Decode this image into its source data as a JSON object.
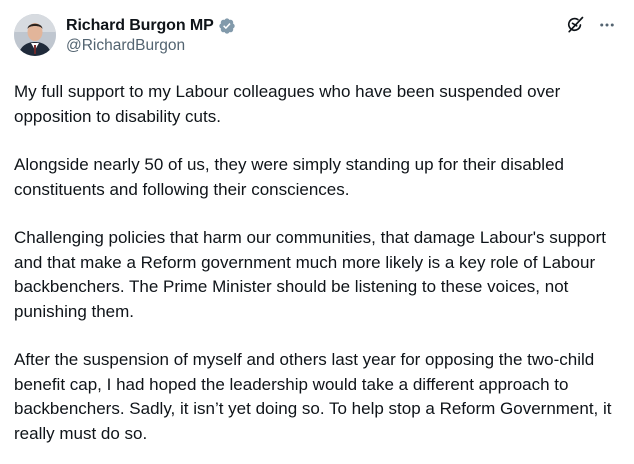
{
  "author": {
    "display_name": "Richard Burgon MP",
    "handle": "@RichardBurgon",
    "verified": true,
    "verified_color": "#829aab"
  },
  "icons": {
    "avatar": "avatar-photo",
    "verified": "verified-badge-icon",
    "grok": "grok-icon",
    "more": "more-options-icon"
  },
  "tweet": {
    "paragraphs": [
      "My full support to my Labour colleagues who have been suspended over opposition to disability cuts.",
      "Alongside nearly 50 of us, they were simply standing up for their disabled constituents and following their consciences.",
      "Challenging policies that harm our communities, that damage Labour's support and that make a Reform government much more likely is a key role of Labour backbenchers. The Prime Minister should be listening to these voices, not punishing them.",
      "After the suspension of myself and others last year for opposing the two-child benefit cap, I had hoped the leadership would take a different approach to backbenchers. Sadly, it isn’t yet doing so. To help stop a Reform Government, it really must do so."
    ]
  },
  "colors": {
    "text": "#0f1419",
    "secondary": "#536471",
    "background": "#ffffff"
  }
}
